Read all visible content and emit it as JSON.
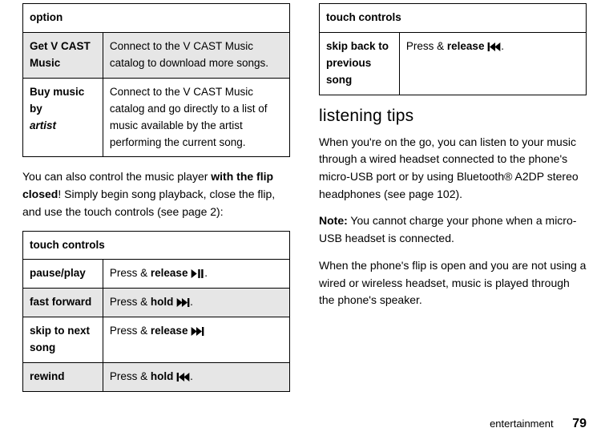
{
  "leftTable": {
    "header": "option",
    "rows": [
      {
        "label_line1": "Get V CAST",
        "label_line2": "Music",
        "desc": "Connect to the V CAST Music catalog to download more songs."
      },
      {
        "label_line1": "Buy music by",
        "label_italic": "artist",
        "desc": "Connect to the V CAST Music catalog and go directly to a list of music available by the artist performing the current song."
      }
    ]
  },
  "para1_a": "You can also control the music player ",
  "para1_b": "with the flip closed",
  "para1_c": "! Simply begin song playback, close the flip, and use the touch controls (see page 2):",
  "touchTable": {
    "header": "touch controls",
    "rows": [
      {
        "label": "pause/play",
        "a": "Press & ",
        "b": "release",
        "c": " ",
        "icon": "play-pause",
        "d": "."
      },
      {
        "label": "fast forward",
        "a": "Press & ",
        "b": "hold",
        "c": " ",
        "icon": "fwd-end",
        "d": "."
      },
      {
        "label": "skip to next song",
        "a": "Press & ",
        "b": "release",
        "c": " ",
        "icon": "fwd-end",
        "d": ""
      },
      {
        "label": "rewind",
        "a": "Press & ",
        "b": "hold",
        "c": " ",
        "icon": "rew-start",
        "d": "."
      }
    ]
  },
  "rightTable": {
    "header": "touch controls",
    "row": {
      "label": "skip back to previous song",
      "a": "Press & ",
      "b": "release",
      "c": " ",
      "icon": "rew-start",
      "d": "."
    }
  },
  "heading": "listening tips",
  "p2": "When you're on the go, you can listen to your music through a wired headset connected to the phone's micro-USB port or by using Bluetooth® A2DP stereo headphones (see page 102).",
  "p3a": "Note:",
  "p3b": " You cannot charge your phone when a micro-USB headset is connected.",
  "p4": "When the phone's flip is open and you are not using a wired or wireless headset, music is played through the phone's speaker.",
  "footer_label": "entertainment",
  "page_num": "79"
}
